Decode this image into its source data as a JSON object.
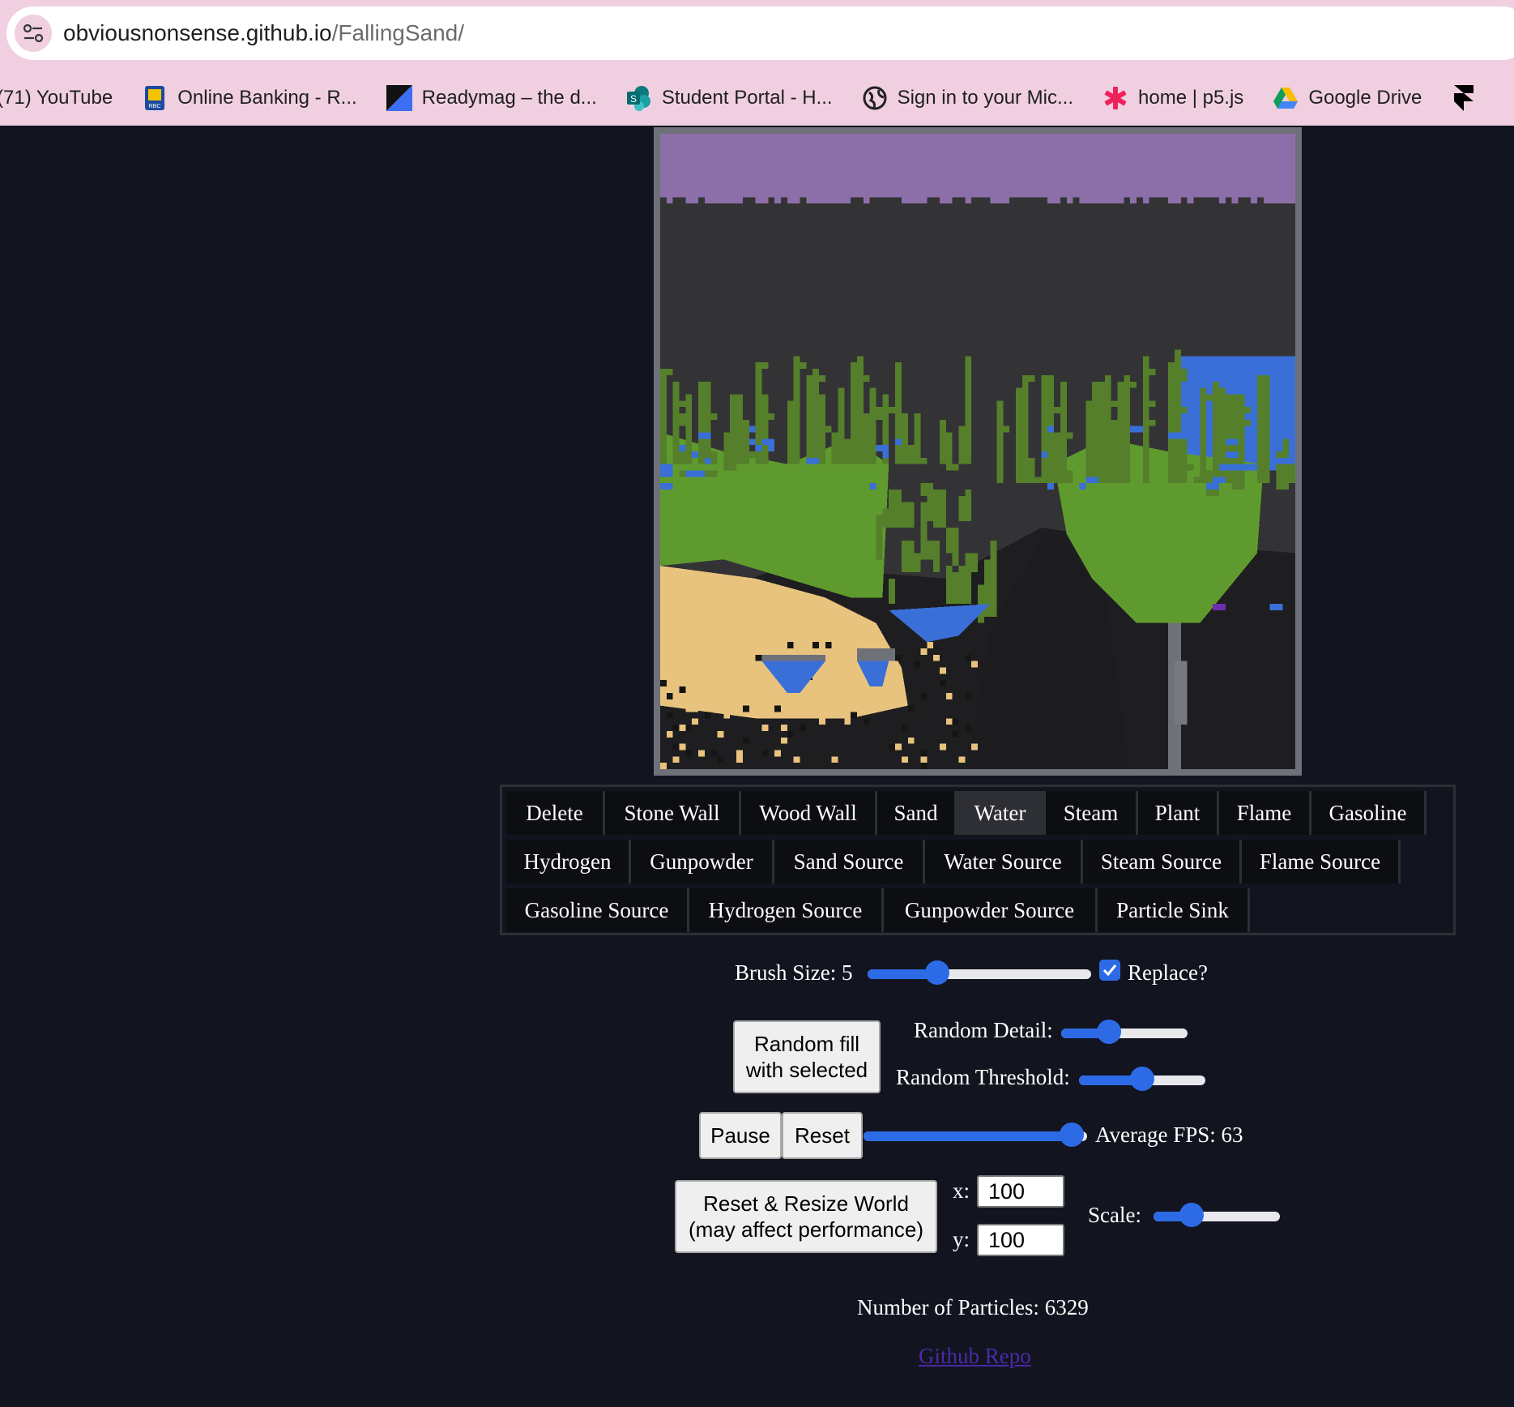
{
  "browser": {
    "url_host": "obviousnonsense.github.io",
    "url_path": "/FallingSand/",
    "bookmarks": [
      {
        "label": "(71) YouTube",
        "icon": "youtube-icon"
      },
      {
        "label": "Online Banking - R...",
        "icon": "rbc-icon"
      },
      {
        "label": "Readymag – the d...",
        "icon": "readymag-icon"
      },
      {
        "label": "Student Portal - H...",
        "icon": "sharepoint-icon"
      },
      {
        "label": "Sign in to your Mic...",
        "icon": "globe-icon"
      },
      {
        "label": "home | p5.js",
        "icon": "p5-asterisk-icon"
      },
      {
        "label": "Google Drive",
        "icon": "google-drive-icon"
      }
    ]
  },
  "colors": {
    "background": "#12141f",
    "accent": "#2d6be6",
    "stone_wall": "#8c6fa8",
    "empty": "#333335",
    "plant": "#5f9a2e",
    "water": "#3a6fd8",
    "sand": "#e8c37e"
  },
  "elements": {
    "rows": [
      [
        "Delete",
        "Stone Wall",
        "Wood Wall",
        "Sand",
        "Water",
        "Steam",
        "Plant",
        "Flame",
        "Gasoline"
      ],
      [
        "Hydrogen",
        "Gunpowder",
        "Sand Source",
        "Water Source",
        "Steam Source",
        "Flame Source"
      ],
      [
        "Gasoline Source",
        "Hydrogen Source",
        "Gunpowder Source",
        "Particle Sink"
      ]
    ],
    "selected": "Water"
  },
  "controls": {
    "brush_size_label": "Brush Size: 5",
    "brush_size_value": 5,
    "brush_slider_fraction": 0.31,
    "replace_label": "Replace?",
    "replace_checked": true,
    "random_fill_line1": "Random fill",
    "random_fill_line2": "with selected",
    "random_detail_label": "Random Detail:",
    "random_detail_fraction": 0.38,
    "random_threshold_label": "Random Threshold:",
    "random_threshold_fraction": 0.5,
    "pause_label": "Pause",
    "reset_label": "Reset",
    "speed_fraction": 0.93,
    "fps_label": "Average FPS: 63",
    "resize_line1": "Reset & Resize World",
    "resize_line2": "(may affect performance)",
    "x_label": "x:",
    "x_value": "100",
    "y_label": "y:",
    "y_value": "100",
    "scale_label": "Scale:",
    "scale_fraction": 0.3,
    "particles_label": "Number of Particles: 6329",
    "github_link": "Github Repo"
  }
}
